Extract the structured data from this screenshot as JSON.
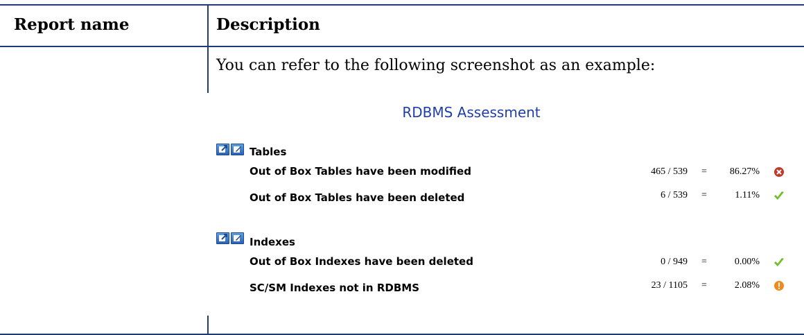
{
  "table": {
    "headers": {
      "report_name": "Report name",
      "description": "Description"
    },
    "intro_text": "You can refer to the following screenshot as an example:"
  },
  "screenshot": {
    "title": "RDBMS Assessment",
    "sections": [
      {
        "title": "Tables",
        "rows": [
          {
            "label": "Out of Box Tables have been modified",
            "ratio": "465 / 539",
            "eq": "=",
            "percent": "86.27%",
            "status": "error-icon"
          },
          {
            "label": "Out of Box Tables have been deleted",
            "ratio": "6 / 539",
            "eq": "=",
            "percent": "1.11%",
            "status": "checkmark-icon"
          }
        ]
      },
      {
        "title": "Indexes",
        "rows": [
          {
            "label": "Out of Box Indexes have been deleted",
            "ratio": "0 / 949",
            "eq": "=",
            "percent": "0.00%",
            "status": "checkmark-icon"
          },
          {
            "label": "SC/SM Indexes not in RDBMS",
            "ratio": "23 / 1105",
            "eq": "=",
            "percent": "2.08%",
            "status": "warning-icon"
          }
        ]
      }
    ]
  },
  "colors": {
    "rule": "#1f3a7a",
    "title_blue": "#1f3fa8",
    "error": "#c0392b",
    "ok": "#6fbf2a",
    "warning": "#f08a1c"
  }
}
